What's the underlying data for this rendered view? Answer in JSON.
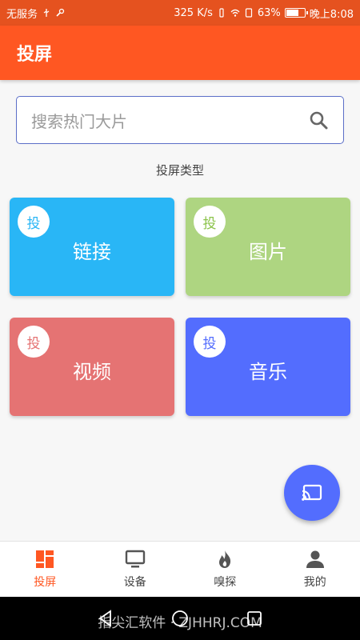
{
  "status_bar": {
    "carrier": "无服务",
    "speed": "325 K/s",
    "battery": "63%",
    "battery_level": 0.63,
    "time": "晚上8:08"
  },
  "app_bar": {
    "title": "投屏"
  },
  "search": {
    "placeholder": "搜索热门大片",
    "icon": "search-icon"
  },
  "section": {
    "title": "投屏类型"
  },
  "tiles": [
    {
      "badge": "投",
      "label": "链接",
      "color": "#29b6f6"
    },
    {
      "badge": "投",
      "label": "图片",
      "color": "#aed581"
    },
    {
      "badge": "投",
      "label": "视频",
      "color": "#e57373"
    },
    {
      "badge": "投",
      "label": "音乐",
      "color": "#536dfe"
    }
  ],
  "fab": {
    "icon": "cast-icon",
    "color": "#536dfe"
  },
  "bottom_nav": {
    "items": [
      {
        "label": "投屏",
        "icon": "grid-icon",
        "active": true
      },
      {
        "label": "设备",
        "icon": "monitor-icon",
        "active": false
      },
      {
        "label": "嗅探",
        "icon": "flame-icon",
        "active": false
      },
      {
        "label": "我的",
        "icon": "person-icon",
        "active": false
      }
    ],
    "active_color": "#ff5722"
  },
  "watermark": "指尖汇软件 · ZJHHRJ.COM",
  "colors": {
    "primary": "#ff5722",
    "status_bar": "#e5521f"
  }
}
